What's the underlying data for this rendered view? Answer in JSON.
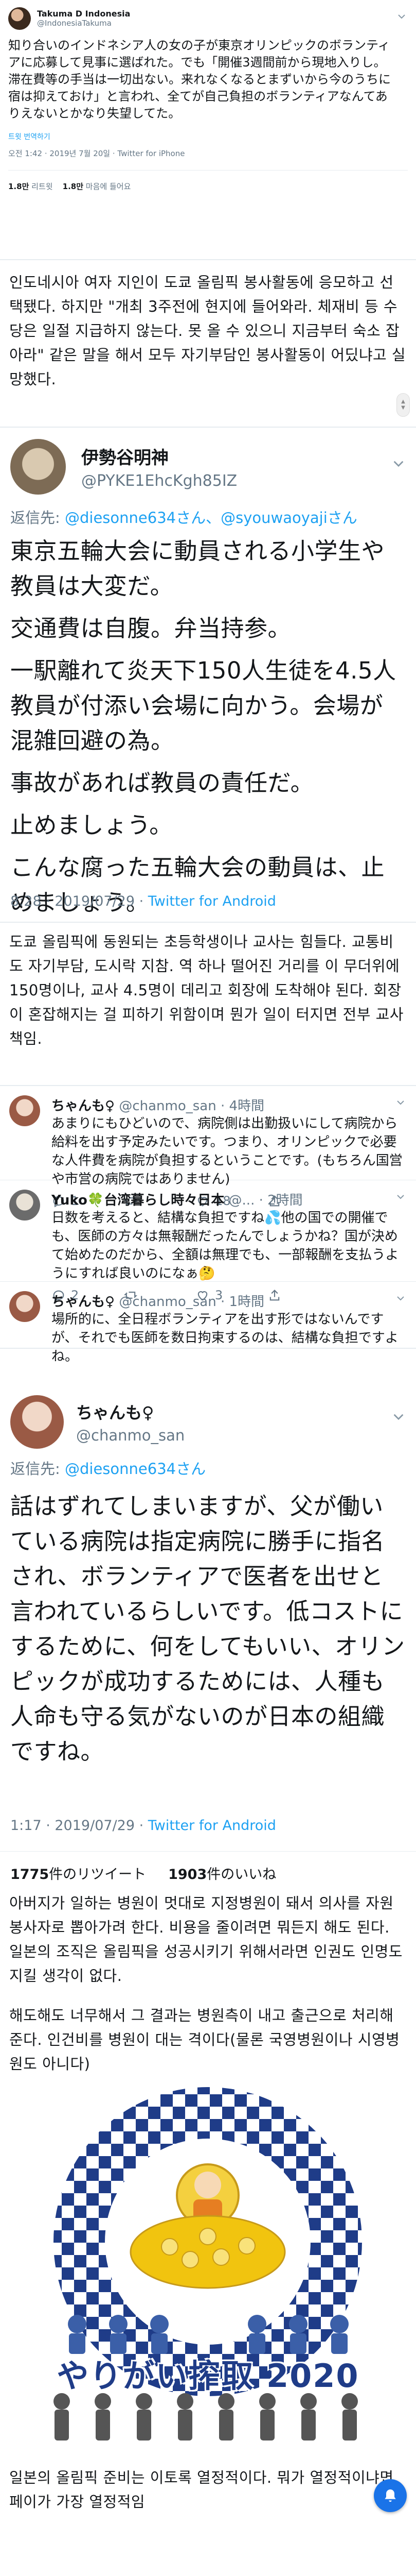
{
  "tweet1": {
    "display_name": "Takuma D Indonesia",
    "handle": "@IndonesiaTakuma",
    "text": "知り合いのインドネシア人の女の子が東京オリンピックのボランティアに応募して見事に選ばれた。でも「開催3週間前から現地入りし。滞在費等の手当は一切出ない。来れなくなるとまずいから今のうちに宿は抑えておけ」と言われ、全てが自己負担のボランティアなんてありえないとかなり失望してた。",
    "translate_link": "트윗 번역하기",
    "time": "오전 1:42 · 2019년 7월 20일 · Twitter for iPhone",
    "retweets_count": "1.8만",
    "retweets_label": "리트윗",
    "likes_count": "1.8만",
    "likes_label": "마음에 들어요"
  },
  "kr1": "인도네시아 여자 지인이 도쿄 올림픽 봉사활동에 응모하고 선택됐다. 하지만 \"개최 3주전에 현지에 들어와라. 체재비 등 수당은 일절 지급하지 않는다. 못 올 수 있으니 지금부터 숙소 잡아라\" 같은 말을 해서 모두 자기부담인 봉사활동이 어딨냐고 실망했다.",
  "tweet2": {
    "display_name": "伊勢谷明神",
    "handle": "@PYKE1EhcKgh85IZ",
    "reply_prefix": "返信先: ",
    "reply_to": "@diesonne634さん、@syouwaoyajiさん",
    "paragraphs": [
      "東京五輪大会に動員される小学生や教員は大変だ。",
      "交通費は自腹。弁当持参。",
      "一駅離れて炎天下150人生徒を4.5人教員が付添い会場に向かう。会場が混雑回避の為。",
      "事故があれば教員の責任だ。",
      "止めましょう。",
      "こんな腐った五輪大会の動員は、止めましょう。"
    ],
    "time": "8:28 · 2019/07/29 · ",
    "via": "Twitter for Android"
  },
  "kr2": "도쿄 올림픽에 동원되는 초등학생이나 교사는 힘들다. 교통비도 자기부담, 도시락 지참. 역 하나 떨어진 거리를 이 무더위에 150명이나, 교사 4.5명이 데리고 회장에 도착해야 된다. 회장이 혼잡해지는 걸 피하기 위함이며 뭔가 일이 터지면 전부 교사 책임.",
  "replies": [
    {
      "name": "ちゃんも♀",
      "meta": "@chanmo_san · 4時間",
      "text": "あまりにもひどいので、病院側は出勤扱いにして病院から給料を出す予定みたいです。つまり、オリンピックで必要な人件費を病院が負担するということです。(もちろん国営や市営の病院ではありません)",
      "reply_count": "1",
      "retweet_count": "",
      "like_count": "18"
    },
    {
      "name": "Yuko🍀台湾暮らし時々日本",
      "meta": "@... · 2時間",
      "text": "日数を考えると、結構な負担ですね💦他の国での開催でも、医師の方々は無報酬だったんでしょうかね？国が決めて始めたのだから、全額は無理でも、一部報酬を支払うようにすれば良いのになぁ🤔",
      "reply_count": "2",
      "retweet_count": "",
      "like_count": "3"
    },
    {
      "name": "ちゃんも♀",
      "meta": "@chanmo_san · 1時間",
      "text": "場所的に、全日程ボランティアを出す形ではないんですが、それでも医師を数日拘束するのは、結構な負担ですよね。",
      "reply_count": "1",
      "retweet_count": "",
      "like_count": ""
    }
  ],
  "tweet3": {
    "display_name": "ちゃんも♀",
    "handle": "@chanmo_san",
    "reply_prefix": "返信先: ",
    "reply_to": "@diesonne634さん",
    "text": "話はずれてしまいますが、父が働いている病院は指定病院に勝手に指名され、ボランティアで医者を出せと言われているらしいです。低コストにするために、何をしてもいい、オリンピックが成功するためには、人種も人命も守る気がないのが日本の組織ですね。",
    "time": "1:17 · 2019/07/29 · ",
    "via": "Twitter for Android",
    "retweets_count": "1775",
    "retweets_label": "件のリツイート",
    "likes_count": "1903",
    "likes_label": "件のいいね"
  },
  "kr3": "아버지가 일하는 병원이 멋대로 지정병원이 돼서 의사를 자원봉사자로 뽑아가려 한다. 비용을 줄이려면 뭐든지 해도 된다. 일본의 조직은 올림픽을 성공시키기 위해서라면 인권도 인명도 지킬 생각이 없다.",
  "kr4": "해도해도 너무해서 그 결과는 병원측이 내고 출근으로 처리해준다. 인건비를 병원이 대는 격이다(물론 국영병원이나 시영병원도 아니다)",
  "poster_text": "やりがい搾取 2020",
  "kr5": "일본의 올림픽 준비는 이토록 열정적이다. 뭐가 열정적이냐면 페이가 가장 열정적임",
  "colors": {
    "twitter_blue": "#1da1f2",
    "poster_blue": "#1f3c88",
    "poster_bg": "#2a4ea3"
  }
}
